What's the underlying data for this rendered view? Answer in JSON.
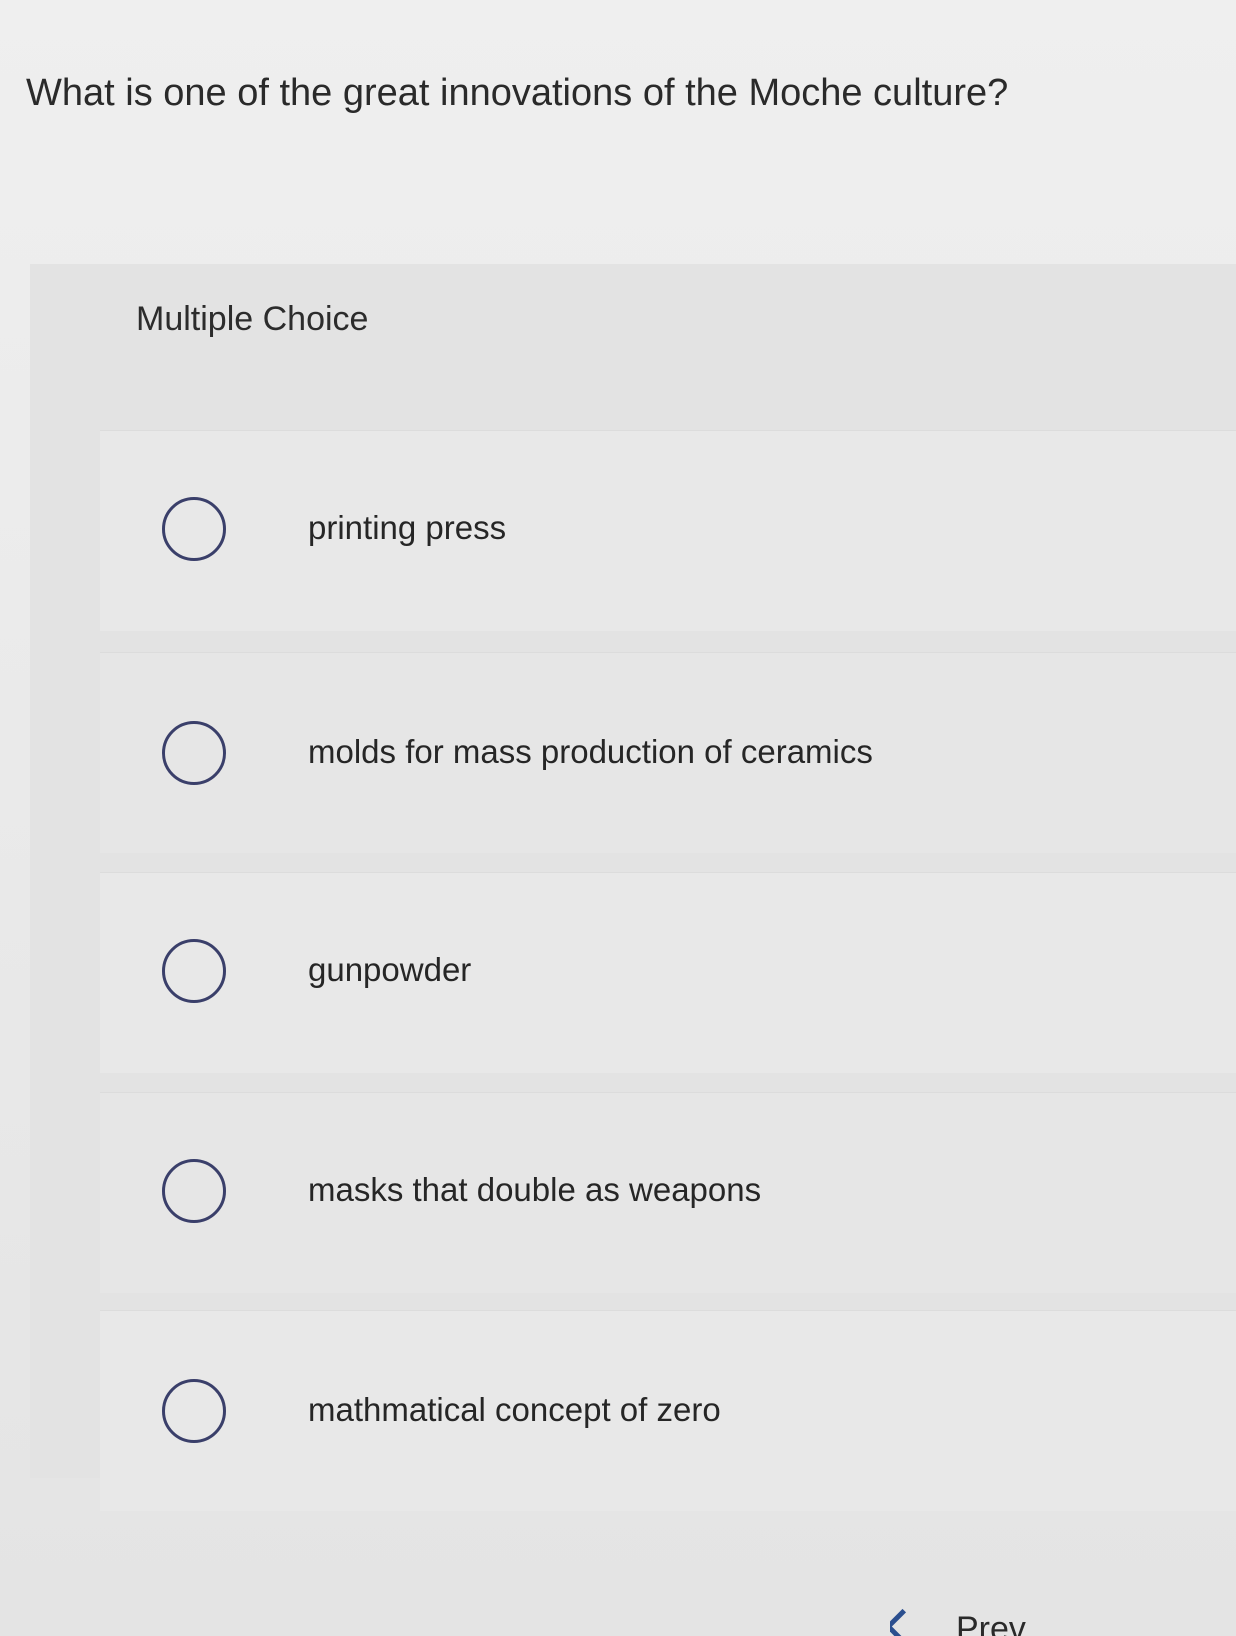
{
  "question": {
    "text": "What is one of the great innovations of the Moche culture?"
  },
  "question_type": {
    "label": "Multiple Choice"
  },
  "options": [
    {
      "label": "printing press",
      "selected": false
    },
    {
      "label": "molds for mass production of ceramics",
      "selected": false
    },
    {
      "label": "gunpowder",
      "selected": false
    },
    {
      "label": "masks that double as weapons",
      "selected": false
    },
    {
      "label": "mathmatical concept of zero",
      "selected": false
    }
  ],
  "nav": {
    "prev_label": "Prev"
  },
  "colors": {
    "radio_border": "#3a3f6a",
    "nav_accent": "#2b4f8f"
  },
  "icons": {
    "radio": "radio-unselected-icon",
    "prev": "chevron-left-icon"
  }
}
